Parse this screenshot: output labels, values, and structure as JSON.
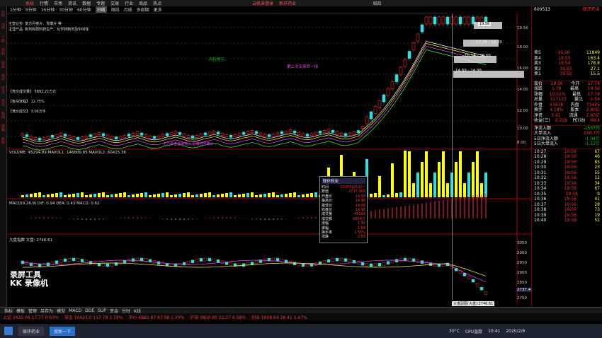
{
  "menu": {
    "items": [
      "系统",
      "行情",
      "市场",
      "资讯",
      "数据",
      "专题",
      "交易",
      "行业",
      "商品",
      "热点"
    ],
    "center": [
      "云帆来登录",
      "新环药业"
    ],
    "right": [
      "周四"
    ]
  },
  "period_tabs": [
    "1分钟",
    "5分钟",
    "15分钟",
    "30分钟",
    "60分钟",
    "日线",
    "周线",
    "月线",
    "多周期",
    "更多"
  ],
  "selected_period": "日线",
  "stock_code": "600513",
  "stock_name": "联环药业",
  "left_strip": [
    "分时",
    "K线",
    "个股",
    "资料",
    "自选",
    "板块",
    "综合",
    "资讯",
    "新闻",
    "策略",
    "机构"
  ],
  "info": {
    "line1": "主营业务: 复方丹参片、胃康片 等",
    "line2": "主营产品: 制剂和原料药生产、化学药制剂及中间体",
    "line3": "【竞价成交量】 5892.21万元",
    "line4": "【板块涨幅】 12.75%",
    "line5": "【竞价成交】 3.06万手"
  },
  "annotations": {
    "top_tag": "19.56",
    "price_a": "17.78 - 19.20",
    "price_b": "16.16 - 16.66",
    "price_c": "14.69 - 14.98",
    "ma_label": "第二次买卖转一拐",
    "green_label": "风险警示",
    "pink_label": "主力资金连续流入 见底信号确认",
    "left_price_label": "12.75%"
  },
  "panels": {
    "vol": "VOLUME: 45294.89  MAVOL1: 146809.85  MAVOL2: 60415.36",
    "macd": "MACD(9,26,9)  DIF: 0.94  DEA: 0.43  MACD: 0.62",
    "index": "大盘指数  大盘: 2746.61"
  },
  "price_axis": [
    "19.56",
    "18.00",
    "16.00",
    "14.00",
    "12.00",
    "10.00",
    "8.00"
  ],
  "index_axis": [
    "3050",
    "3000",
    "2950",
    "2900",
    "2850",
    "2800",
    "2750"
  ],
  "index_last": "2737.47",
  "right_panel": {
    "code": "600513",
    "name": "联环药业",
    "asks": [
      {
        "lvl": "卖5",
        "price": "19.56",
        "vol": "11849"
      },
      {
        "lvl": "卖4",
        "price": "19.55",
        "vol": "163.4"
      },
      {
        "lvl": "卖3",
        "price": "19.54",
        "vol": "178.8"
      },
      {
        "lvl": "卖2",
        "price": "19.53",
        "vol": "27.1"
      },
      {
        "lvl": "卖1",
        "price": "19.52",
        "vol": "15.5"
      }
    ],
    "stats": [
      {
        "k": "现价",
        "v": "19.56",
        "k2": "今开",
        "v2": "17.78"
      },
      {
        "k": "涨跌",
        "v": "1.78",
        "k2": "最高",
        "v2": "19.56"
      },
      {
        "k": "涨幅",
        "v": "10.01%",
        "k2": "最低",
        "v2": "17.78"
      },
      {
        "k": "总量",
        "v": "117113",
        "k2": "量比",
        "v2": "1.54"
      },
      {
        "k": "外盘",
        "v": "43678",
        "k2": "内盘",
        "v2": "73435"
      },
      {
        "k": "换手",
        "v": "4.18%",
        "k2": "股本",
        "v2": "2.80亿"
      },
      {
        "k": "净资",
        "v": "3.41",
        "k2": "流通",
        "v2": "2.80亿"
      },
      {
        "k": "收益(三)",
        "v": "0.228",
        "k2": "PE(动)",
        "v2": "68.4"
      }
    ],
    "flows": [
      {
        "k": "净流入额",
        "v": "-1557万"
      },
      {
        "k": "大单流入",
        "v": "230.7万"
      },
      {
        "k": "5日净流入额",
        "v": "-1.04亿"
      },
      {
        "k": "5日大单流入",
        "v": "-1.52亿"
      }
    ],
    "ticks": [
      {
        "t": "10:27",
        "p": "19.56",
        "v": "67"
      },
      {
        "t": "10:28",
        "p": "19.56",
        "v": "46"
      },
      {
        "t": "10:29",
        "p": "19.56",
        "v": "85"
      },
      {
        "t": "10:30",
        "p": "19.56",
        "v": "23"
      },
      {
        "t": "10:31",
        "p": "19.56",
        "v": "55"
      },
      {
        "t": "10:32",
        "p": "19.56",
        "v": "12"
      },
      {
        "t": "10:33",
        "p": "19.56",
        "v": "34"
      },
      {
        "t": "10:34",
        "p": "19.56",
        "v": "67"
      },
      {
        "t": "10:35",
        "p": "19.56",
        "v": "9"
      },
      {
        "t": "10:36",
        "p": "19.56",
        "v": "41"
      },
      {
        "t": "10:37",
        "p": "19.56",
        "v": "28"
      },
      {
        "t": "10:38",
        "p": "19.56",
        "v": "73"
      },
      {
        "t": "10:39",
        "p": "19.56",
        "v": "19"
      },
      {
        "t": "10:40",
        "p": "19.56",
        "v": "52"
      }
    ]
  },
  "tooltip": {
    "title": "联环药业",
    "rows": [
      {
        "k": "时间",
        "v": "2020/02/03/一"
      },
      {
        "k": "数值",
        "v": "2737.469"
      },
      {
        "k": "开盘价",
        "v": "14.69"
      },
      {
        "k": "最高价",
        "v": "14.98"
      },
      {
        "k": "最低价",
        "v": "14.69"
      },
      {
        "k": "收盘价",
        "v": "14.98"
      },
      {
        "k": "成交量",
        "v": "45294"
      },
      {
        "k": "成交额",
        "v": "6654万"
      },
      {
        "k": "涨幅",
        "v": "1.56"
      },
      {
        "k": "振幅",
        "v": "1.99"
      },
      {
        "k": "换手率",
        "v": "1.58%"
      },
      {
        "k": "涨跌",
        "v": "2.60"
      }
    ]
  },
  "cursor_label": "大盘副图(大盘):2746.61",
  "bottom_tabs": [
    "指标",
    "模板",
    "管理",
    "另存为",
    "模型",
    "MACD",
    "DDE",
    "SUP",
    "资金",
    "分时",
    "K线"
  ],
  "index_bar": [
    "上证 2635.06  17.77  0.63%",
    "深证 10423.0  117.78  1.18%",
    "中小 6883.87  87.98  1.30%",
    "沪深 3850.90  22.37  0.58%",
    "创业 1908.64  28.41  1.47%"
  ],
  "watermark": {
    "line1": "录屏工具",
    "line2": "KK 录像机"
  },
  "taskbar": {
    "app1": "联环药业",
    "app2": "搜索一下",
    "clock": "10:41",
    "date": "2020/2/6",
    "temp": "30°C",
    "cpu": "CPU温度"
  },
  "colors": {
    "up": "#ff3030",
    "down": "#30e0e0",
    "ma5": "#ffffff",
    "ma10": "#ffff30",
    "ma20": "#ff40ff",
    "ma60": "#30ff30",
    "vol_up": "#ffff00",
    "vol_down": "#30e0e0"
  }
}
